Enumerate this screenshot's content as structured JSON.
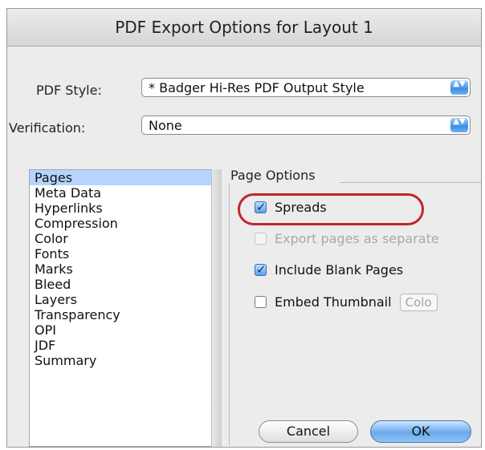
{
  "dialog": {
    "title": "PDF Export Options for Layout 1"
  },
  "pdf_style": {
    "label": "PDF Style:",
    "value": "* Badger Hi-Res PDF Output Style"
  },
  "verification": {
    "label": "Verification:",
    "value": "None"
  },
  "stepper_glyph": "▲▼",
  "categories": [
    "Pages",
    "Meta Data",
    "Hyperlinks",
    "Compression",
    "Color",
    "Fonts",
    "Marks",
    "Bleed",
    "Layers",
    "Transparency",
    "OPI",
    "JDF",
    "Summary"
  ],
  "selected_category": "Pages",
  "page_options": {
    "title": "Page Options",
    "spreads": {
      "label": "Spreads",
      "checked": true
    },
    "export_separate": {
      "label": "Export pages as separate",
      "checked": false,
      "enabled": false
    },
    "include_blank": {
      "label": "Include Blank Pages",
      "checked": true
    },
    "embed_thumbnail": {
      "label": "Embed Thumbnail",
      "checked": false,
      "popup_value": "Colo"
    }
  },
  "buttons": {
    "cancel": "Cancel",
    "ok": "OK"
  },
  "colors": {
    "selection": "#b5d5ff",
    "highlight_ring": "#c0272d",
    "accent": "#3f8de3"
  }
}
